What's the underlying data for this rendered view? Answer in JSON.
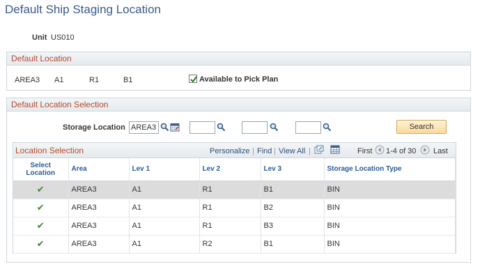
{
  "page": {
    "title": "Default Ship Staging Location"
  },
  "unit": {
    "label": "Unit",
    "value": "US010"
  },
  "default_location": {
    "header": "Default Location",
    "area": "AREA3",
    "lev1": "A1",
    "lev2": "R1",
    "lev3": "B1",
    "available_label": "Available to Pick Plan",
    "available_checked": true
  },
  "selection": {
    "header": "Default Location Selection",
    "storage_label": "Storage Location",
    "storage_value": "AREA3",
    "search_label": "Search"
  },
  "grid": {
    "title": "Location Selection",
    "nav": {
      "personalize": "Personalize",
      "sep1": "|",
      "find": "Find",
      "sep2": "|",
      "view_all": "View All",
      "sep3": "|",
      "first": "First",
      "range": "1-4 of 30",
      "last": "Last"
    },
    "headers": {
      "select_line1": "Select",
      "select_line2": "Location",
      "area": "Area",
      "lev1": "Lev 1",
      "lev2": "Lev 2",
      "lev3": "Lev 3",
      "type": "Storage Location Type"
    },
    "rows": [
      {
        "area": "AREA3",
        "lev1": "A1",
        "lev2": "R1",
        "lev3": "B1",
        "type": "BIN"
      },
      {
        "area": "AREA3",
        "lev1": "A1",
        "lev2": "R1",
        "lev3": "B2",
        "type": "BIN"
      },
      {
        "area": "AREA3",
        "lev1": "A1",
        "lev2": "R1",
        "lev3": "B3",
        "type": "BIN"
      },
      {
        "area": "AREA3",
        "lev1": "A1",
        "lev2": "R2",
        "lev3": "B1",
        "type": "BIN"
      }
    ],
    "check_glyph": "✔"
  },
  "colors": {
    "title": "#3b5a8a",
    "section_header": "#b04a2a",
    "link": "#2a4f7c",
    "selected_row": "#dcdcdc"
  }
}
